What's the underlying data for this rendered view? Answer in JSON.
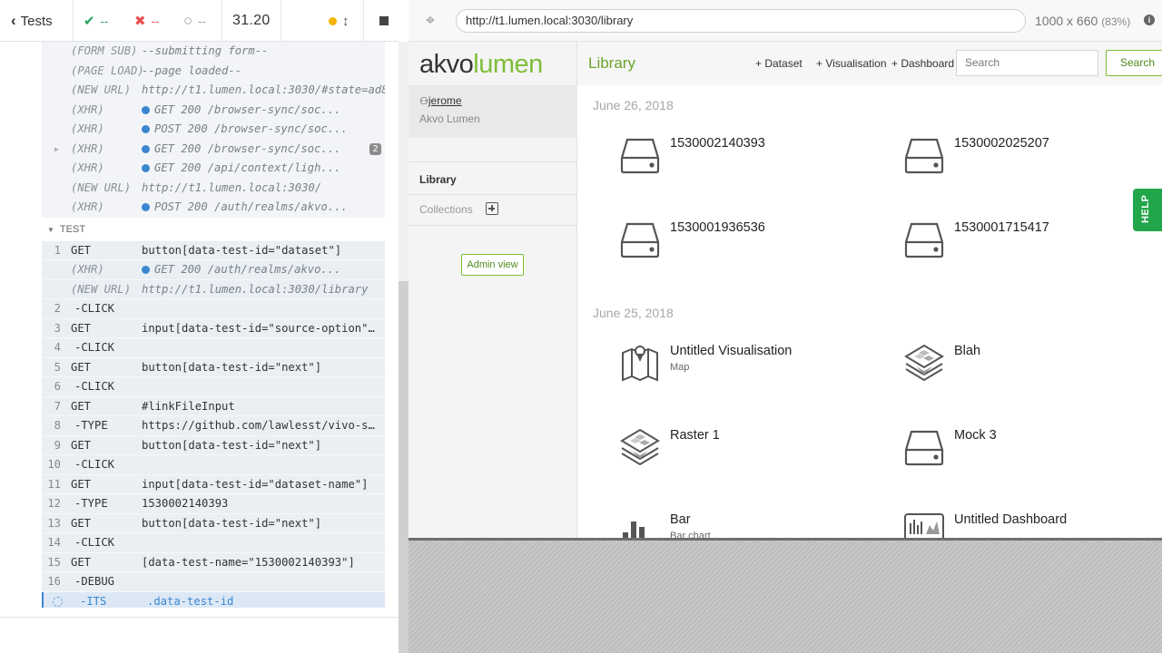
{
  "runner": {
    "tests_label": "Tests",
    "passed": "--",
    "failed": "--",
    "pending": "--",
    "duration": "31.20"
  },
  "log": {
    "pre_rows": [
      {
        "event": "(FORM SUB)",
        "message": "--submitting form--"
      },
      {
        "event": "(PAGE LOAD)",
        "message": "--page loaded--"
      },
      {
        "event": "(NEW URL)",
        "message": "http://t1.lumen.local:3030/#state=ad828fb..."
      },
      {
        "event": "(XHR)",
        "message": "GET 200 /browser-sync/soc..."
      },
      {
        "event": "(XHR)",
        "message": "POST 200 /browser-sync/soc..."
      },
      {
        "event": "(XHR)",
        "message": "GET 200 /browser-sync/soc...",
        "badge": "2"
      },
      {
        "event": "(XHR)",
        "message": "GET 200 /api/context/ligh..."
      },
      {
        "event": "(NEW URL)",
        "message": "http://t1.lumen.local:3030/"
      },
      {
        "event": "(XHR)",
        "message": "POST 200 /auth/realms/akvo..."
      }
    ],
    "test_label": "TEST",
    "commands": [
      {
        "num": "1",
        "name": "GET",
        "arg": "button[data-test-id=\"dataset\"]"
      },
      {
        "num": "",
        "name": "(XHR)",
        "arg": "GET 200 /auth/realms/akvo...",
        "xhr": true,
        "dot": true
      },
      {
        "num": "",
        "name": "(NEW URL)",
        "arg": "http://t1.lumen.local:3030/library",
        "xhr": true
      },
      {
        "num": "2",
        "name": "-CLICK",
        "arg": "",
        "child": true
      },
      {
        "num": "3",
        "name": "GET",
        "arg": "input[data-test-id=\"source-option\"]..."
      },
      {
        "num": "4",
        "name": "-CLICK",
        "arg": "",
        "child": true
      },
      {
        "num": "5",
        "name": "GET",
        "arg": "button[data-test-id=\"next\"]"
      },
      {
        "num": "6",
        "name": "-CLICK",
        "arg": "",
        "child": true
      },
      {
        "num": "7",
        "name": "GET",
        "arg": "#linkFileInput"
      },
      {
        "num": "8",
        "name": "-TYPE",
        "arg": "https://github.com/lawlesst/vivo-sa...",
        "child": true
      },
      {
        "num": "9",
        "name": "GET",
        "arg": "button[data-test-id=\"next\"]"
      },
      {
        "num": "10",
        "name": "-CLICK",
        "arg": "",
        "child": true
      },
      {
        "num": "11",
        "name": "GET",
        "arg": "input[data-test-id=\"dataset-name\"]"
      },
      {
        "num": "12",
        "name": "-TYPE",
        "arg": "1530002140393",
        "child": true
      },
      {
        "num": "13",
        "name": "GET",
        "arg": "button[data-test-id=\"next\"]"
      },
      {
        "num": "14",
        "name": "-CLICK",
        "arg": "",
        "child": true
      },
      {
        "num": "15",
        "name": "GET",
        "arg": "[data-test-name=\"1530002140393\"]"
      },
      {
        "num": "16",
        "name": "-DEBUG",
        "arg": "",
        "child": true
      },
      {
        "num": "",
        "name": "-ITS",
        "arg": ".data-test-id",
        "active": true
      }
    ]
  },
  "browser": {
    "url": "http://t1.lumen.local:3030/library",
    "viewport": "1000 x 660",
    "zoom": "(83%)"
  },
  "app": {
    "logo_part1": "akvo",
    "logo_part2": "lumen",
    "user": "jerome",
    "org": "Akvo Lumen",
    "nav_library": "Library",
    "nav_collections": "Collections",
    "admin_view": "Admin view",
    "title": "Library",
    "links": {
      "dataset": "+ Dataset",
      "visualisation": "+ Visualisation",
      "dashboard": "+ Dashboard"
    },
    "search_placeholder": "Search",
    "search_button": "Search",
    "help": "HELP",
    "groups": [
      {
        "date": "June 26, 2018",
        "items": [
          {
            "title": "1530002140393",
            "subtitle": "",
            "icon": "dataset-icon"
          },
          {
            "title": "1530002025207",
            "subtitle": "",
            "icon": "dataset-icon"
          },
          {
            "title": "1530001936536",
            "subtitle": "",
            "icon": "dataset-icon"
          },
          {
            "title": "1530001715417",
            "subtitle": "",
            "icon": "dataset-icon"
          }
        ]
      },
      {
        "date": "June 25, 2018",
        "items": [
          {
            "title": "Untitled Visualisation",
            "subtitle": "Map",
            "icon": "map-icon"
          },
          {
            "title": "Blah",
            "subtitle": "",
            "icon": "raster-icon"
          },
          {
            "title": "Raster 1",
            "subtitle": "",
            "icon": "raster-icon"
          },
          {
            "title": "Mock 3",
            "subtitle": "",
            "icon": "dataset-icon"
          },
          {
            "title": "Bar",
            "subtitle": "Bar chart",
            "icon": "bar-chart-icon"
          },
          {
            "title": "Untitled Dashboard",
            "subtitle": "",
            "icon": "dashboard-icon"
          }
        ]
      }
    ]
  }
}
